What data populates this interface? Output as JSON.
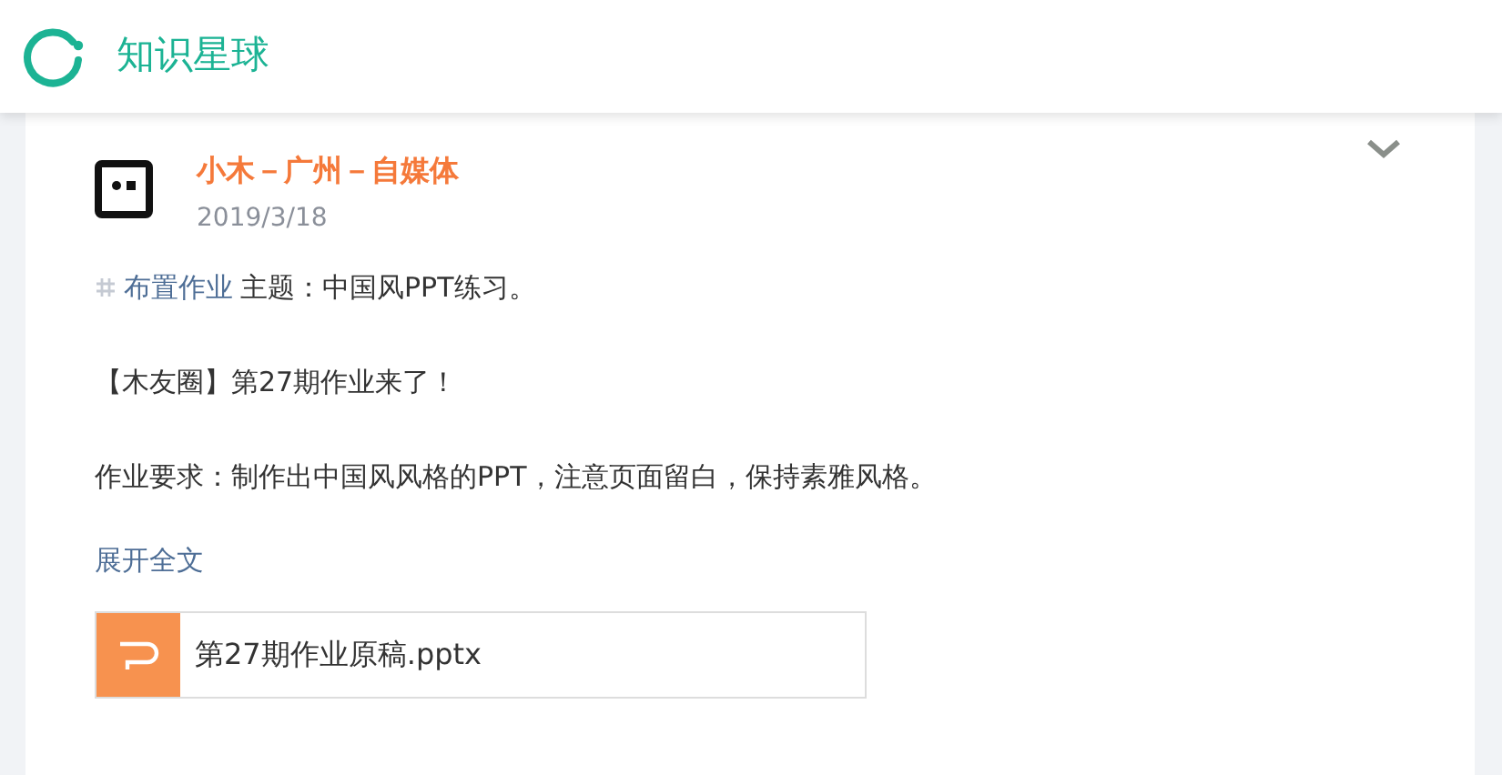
{
  "header": {
    "title": "知识星球"
  },
  "post": {
    "author": "小木－广州－自媒体",
    "date": "2019/3/18",
    "tag": "布置作业",
    "topic": "主题：中国风PPT练习。",
    "paragraphs": [
      "【木友圈】第27期作业来了！",
      "作业要求：制作出中国风风格的PPT，注意页面留白，保持素雅风格。"
    ],
    "expand": "展开全文",
    "attachment": {
      "name": "第27期作业原稿.pptx"
    }
  }
}
